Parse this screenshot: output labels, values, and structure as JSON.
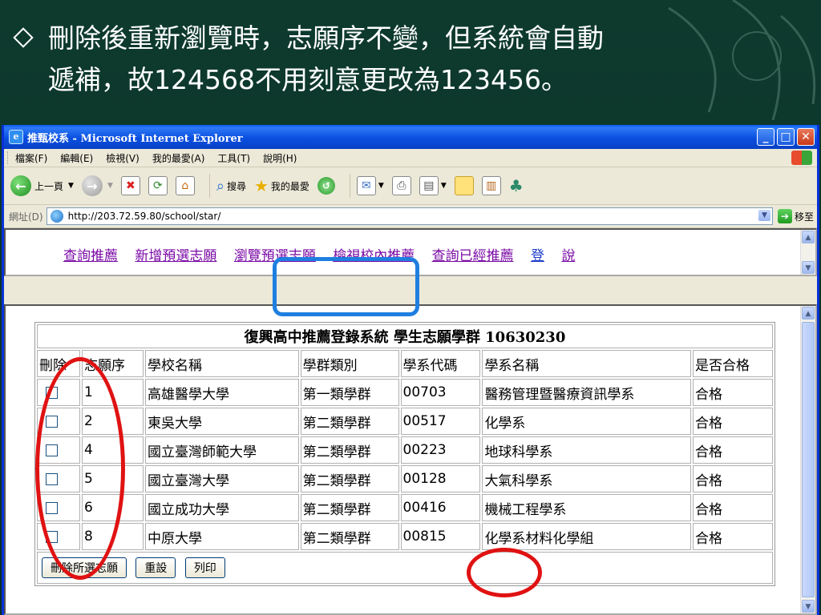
{
  "slide": {
    "bullet_line1": "刪除後重新瀏覽時，志願序不變，但系統會自動",
    "bullet_line2": "遞補，故124568不用刻意更改為123456。"
  },
  "browser": {
    "title": "推甄校系 - Microsoft Internet Explorer",
    "menu": [
      "檔案(F)",
      "編輯(E)",
      "檢視(V)",
      "我的最愛(A)",
      "工具(T)",
      "說明(H)"
    ],
    "toolbar": {
      "back": "上一頁",
      "search": "搜尋",
      "favorites": "我的最愛"
    },
    "address_label": "網址(D)",
    "url": "http://203.72.59.80/school/star/",
    "go": "移至"
  },
  "nav": {
    "links": [
      "查詢推薦",
      "新增預選志願",
      "瀏覽預選志願",
      "檢視校內推薦",
      "查詢已經推薦",
      "登",
      "說"
    ]
  },
  "table": {
    "title": "復興高中推薦登錄系統 學生志願學群 10630230",
    "headers": [
      "刪除",
      "志願序",
      "學校名稱",
      "學群類別",
      "學系代碼",
      "學系名稱",
      "是否合格"
    ],
    "rows": [
      {
        "order": "1",
        "school": "高雄醫學大學",
        "group": "第一類學群",
        "code": "00703",
        "dept": "醫務管理暨醫療資訊學系",
        "pass": "合格"
      },
      {
        "order": "2",
        "school": "東吳大學",
        "group": "第二類學群",
        "code": "00517",
        "dept": "化學系",
        "pass": "合格"
      },
      {
        "order": "4",
        "school": "國立臺灣師範大學",
        "group": "第二類學群",
        "code": "00223",
        "dept": "地球科學系",
        "pass": "合格"
      },
      {
        "order": "5",
        "school": "國立臺灣大學",
        "group": "第二類學群",
        "code": "00128",
        "dept": "大氣科學系",
        "pass": "合格"
      },
      {
        "order": "6",
        "school": "國立成功大學",
        "group": "第二類學群",
        "code": "00416",
        "dept": "機械工程學系",
        "pass": "合格"
      },
      {
        "order": "8",
        "school": "中原大學",
        "group": "第二類學群",
        "code": "00815",
        "dept": "化學系材料化學組",
        "pass": "合格"
      }
    ],
    "buttons": {
      "delete": "刪除所選志願",
      "reset": "重設",
      "print": "列印"
    }
  },
  "colors": {
    "annotation_blue": "#1f7fe0",
    "annotation_red": "#e01212",
    "link_visited": "#7a0aa5"
  }
}
